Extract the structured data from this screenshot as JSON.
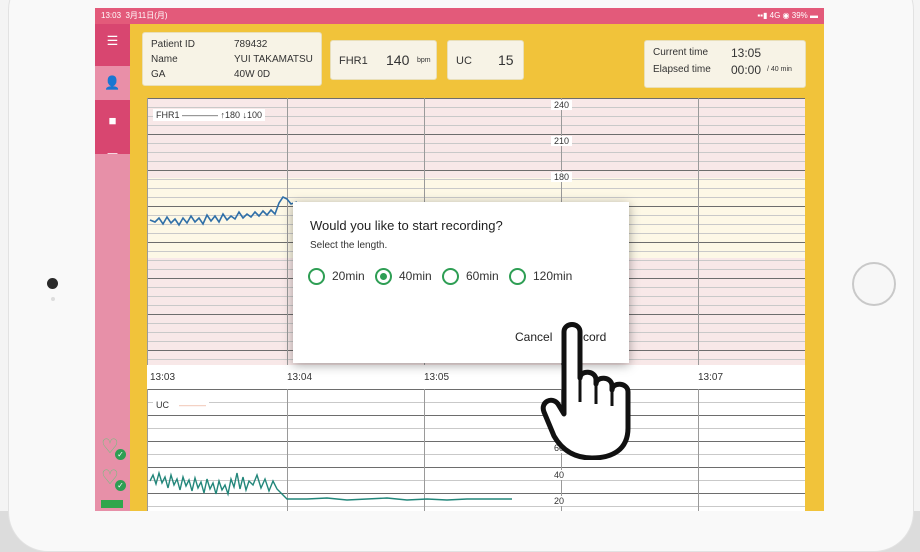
{
  "status_bar": {
    "time": "13:03",
    "date": "3月11日(月)",
    "network": "4G",
    "battery": "39%"
  },
  "patient": {
    "id_label": "Patient ID",
    "id_value": "789432",
    "name_label": "Name",
    "name_value": "YUI TAKAMATSU",
    "ga_label": "GA",
    "ga_value": "40W 0D"
  },
  "fhr": {
    "label": "FHR1",
    "value": "140",
    "unit": "bpm"
  },
  "uc": {
    "label": "UC",
    "value": "15"
  },
  "times": {
    "current_label": "Current time",
    "current_value": "13:05",
    "elapsed_label": "Elapsed time",
    "elapsed_value": "00:00",
    "elapsed_total": "/ 40 min"
  },
  "fhr_chart": {
    "legend": "FHR1",
    "alarm": "↑180 ↓100",
    "scale": [
      "240",
      "210",
      "180"
    ]
  },
  "time_axis": [
    "13:03",
    "13:04",
    "13:05",
    "13:07"
  ],
  "uc_chart": {
    "legend": "UC",
    "scale": [
      "60",
      "40",
      "20"
    ]
  },
  "dialog": {
    "title": "Would you like to start recording?",
    "subtitle": "Select the length.",
    "options": [
      "20min",
      "40min",
      "60min",
      "120min"
    ],
    "selected": "40min",
    "cancel": "Cancel",
    "record": "Record",
    "record_visible": "cord"
  },
  "colors": {
    "accent": "#2e9e54",
    "sidebar": "#d84670",
    "frame": "#f1c33a"
  }
}
